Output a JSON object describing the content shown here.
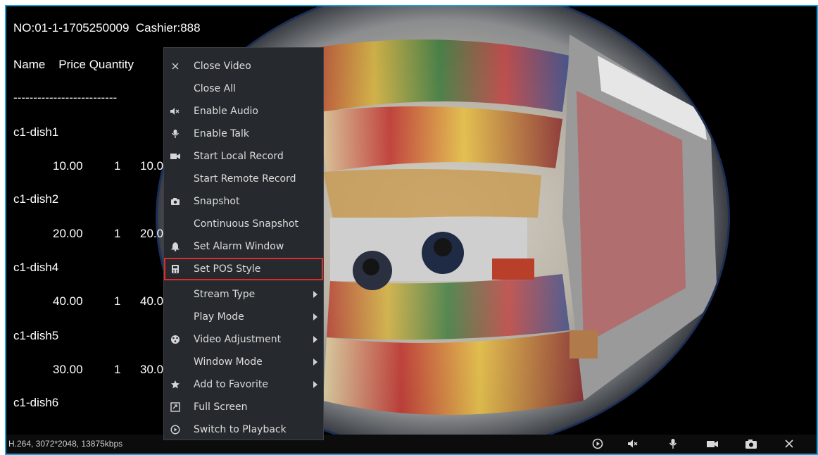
{
  "pos_overlay": {
    "header": "NO:01-1-1705250009  Cashier:888",
    "columns": "Name    Price Quantity",
    "divider": "--------------------------",
    "items": [
      {
        "name": "c1-dish1",
        "price": "10.00",
        "qty": "1",
        "total": "10.0"
      },
      {
        "name": "c1-dish2",
        "price": "20.00",
        "qty": "1",
        "total": "20.0"
      },
      {
        "name": "c1-dish4",
        "price": "40.00",
        "qty": "1",
        "total": "40.0"
      },
      {
        "name": "c1-dish5",
        "price": "30.00",
        "qty": "1",
        "total": "30.0"
      },
      {
        "name": "c1-dish6"
      }
    ]
  },
  "status": {
    "stream_info": "H.264, 3072*2048, 13875kbps"
  },
  "toolbar": {
    "icons": [
      "play-icon",
      "mute-icon",
      "microphone-icon",
      "video-camera-icon",
      "camera-icon",
      "close-icon"
    ]
  },
  "context_menu": {
    "items": [
      {
        "label": "Close Video",
        "icon": "close-icon"
      },
      {
        "label": "Close All",
        "icon": ""
      },
      {
        "label": "Enable Audio",
        "icon": "mute-icon"
      },
      {
        "label": "Enable Talk",
        "icon": "microphone-icon"
      },
      {
        "label": "Start Local Record",
        "icon": "video-camera-icon"
      },
      {
        "label": "Start Remote Record",
        "icon": ""
      },
      {
        "label": "Snapshot",
        "icon": "camera-icon"
      },
      {
        "label": "Continuous Snapshot",
        "icon": ""
      },
      {
        "label": "Set Alarm Window",
        "icon": "bell-icon"
      },
      {
        "label": "Set POS Style",
        "icon": "pos-terminal-icon",
        "highlighted": true
      },
      {
        "label": "Stream Type",
        "icon": "",
        "submenu": true
      },
      {
        "label": "Play Mode",
        "icon": "",
        "submenu": true
      },
      {
        "label": "Video Adjustment",
        "icon": "palette-icon",
        "submenu": true
      },
      {
        "label": "Window Mode",
        "icon": "",
        "submenu": true
      },
      {
        "label": "Add to Favorite",
        "icon": "star-icon",
        "submenu": true
      },
      {
        "label": "Full Screen",
        "icon": "fullscreen-icon"
      },
      {
        "label": "Switch to Playback",
        "icon": "playback-icon"
      }
    ],
    "highlight_color": "#e02b2b"
  },
  "colors": {
    "frame_border": "#1aa0dc",
    "menu_bg": "#262a2e"
  }
}
